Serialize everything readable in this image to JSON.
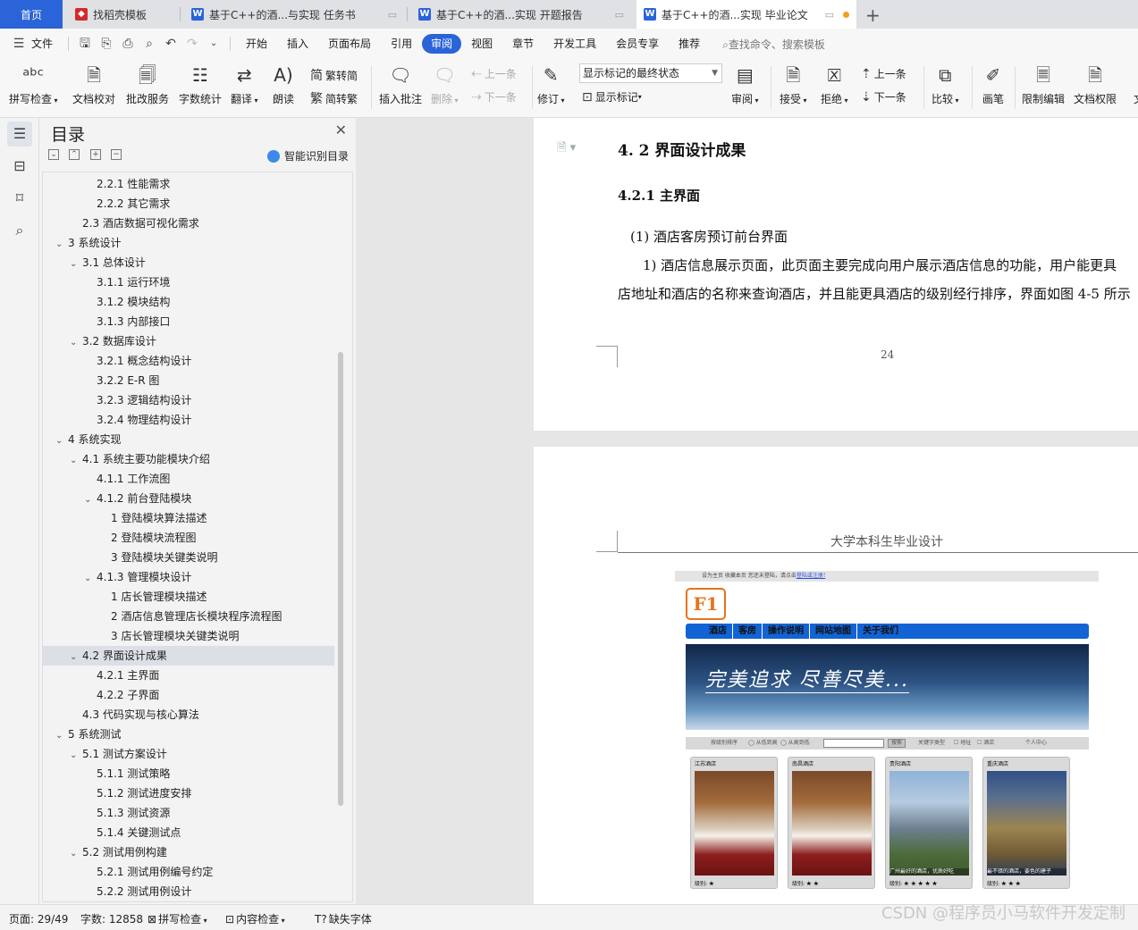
{
  "tabs": [
    {
      "label": "首页"
    },
    {
      "label": "找稻壳模板"
    },
    {
      "label": "基于C++的酒...与实现 任务书"
    },
    {
      "label": "基于C++的酒...实现 开题报告"
    },
    {
      "label": "基于C++的酒...实现 毕业论文"
    }
  ],
  "menu": {
    "file": "文件",
    "items": [
      "开始",
      "插入",
      "页面布局",
      "引用",
      "审阅",
      "视图",
      "章节",
      "开发工具",
      "会员专享",
      "推荐"
    ],
    "active": "审阅",
    "search": "查找命令、搜索模板"
  },
  "ribbon": {
    "spell_check": "拼写检查",
    "doc_proof": "文档校对",
    "batch_service": "批改服务",
    "word_count": "字数统计",
    "translate": "翻译",
    "read_aloud": "朗读",
    "trad_to_simp": "繁转简",
    "simp_to_trad": "简转繁",
    "insert_comment": "插入批注",
    "delete": "删除",
    "prev_comment": "上一条",
    "next_comment": "下一条",
    "track_changes": "修订",
    "markup_state": "显示标记的最终状态",
    "show_markup": "显示标记",
    "review": "审阅",
    "accept": "接受",
    "reject": "拒绝",
    "prev_change": "上一条",
    "next_change": "下一条",
    "compare": "比较",
    "pen": "画笔",
    "restrict_edit": "限制编辑",
    "doc_permission": "文档权限",
    "more": "文"
  },
  "toc": {
    "title": "目录",
    "smart": "智能识别目录",
    "selected": "4.2 界面设计成果",
    "items": [
      {
        "text": "2.2.1 性能需求",
        "level": 3,
        "chev": ""
      },
      {
        "text": "2.2.2 其它需求",
        "level": 3,
        "chev": ""
      },
      {
        "text": "2.3 酒店数据可视化需求",
        "level": 2,
        "chev": ""
      },
      {
        "text": "3 系统设计",
        "level": 1,
        "chev": "v"
      },
      {
        "text": "3.1 总体设计",
        "level": 2,
        "chev": "v"
      },
      {
        "text": "3.1.1 运行环境",
        "level": 3,
        "chev": ""
      },
      {
        "text": "3.1.2 模块结构",
        "level": 3,
        "chev": ""
      },
      {
        "text": "3.1.3 内部接口",
        "level": 3,
        "chev": ""
      },
      {
        "text": "3.2 数据库设计",
        "level": 2,
        "chev": "v"
      },
      {
        "text": "3.2.1 概念结构设计",
        "level": 3,
        "chev": ""
      },
      {
        "text": "3.2.2 E-R 图",
        "level": 3,
        "chev": ""
      },
      {
        "text": "3.2.3 逻辑结构设计",
        "level": 3,
        "chev": ""
      },
      {
        "text": "3.2.4 物理结构设计",
        "level": 3,
        "chev": ""
      },
      {
        "text": "4 系统实现",
        "level": 1,
        "chev": "v"
      },
      {
        "text": "4.1 系统主要功能模块介绍",
        "level": 2,
        "chev": "v"
      },
      {
        "text": "4.1.1 工作流图",
        "level": 3,
        "chev": ""
      },
      {
        "text": "4.1.2 前台登陆模块",
        "level": 3,
        "chev": "v"
      },
      {
        "text": "1 登陆模块算法描述",
        "level": 4,
        "chev": ""
      },
      {
        "text": "2 登陆模块流程图",
        "level": 4,
        "chev": ""
      },
      {
        "text": "3 登陆模块关键类说明",
        "level": 4,
        "chev": ""
      },
      {
        "text": "4.1.3 管理模块设计",
        "level": 3,
        "chev": "v"
      },
      {
        "text": "1 店长管理模块描述",
        "level": 4,
        "chev": ""
      },
      {
        "text": "2 酒店信息管理店长模块程序流程图",
        "level": 4,
        "chev": ""
      },
      {
        "text": "3 店长管理模块关键类说明",
        "level": 4,
        "chev": ""
      },
      {
        "text": "4.2 界面设计成果",
        "level": 2,
        "chev": "v"
      },
      {
        "text": "4.2.1 主界面",
        "level": 3,
        "chev": ""
      },
      {
        "text": "4.2.2 子界面",
        "level": 3,
        "chev": ""
      },
      {
        "text": "4.3 代码实现与核心算法",
        "level": 2,
        "chev": ""
      },
      {
        "text": "5 系统测试",
        "level": 1,
        "chev": "v"
      },
      {
        "text": "5.1 测试方案设计",
        "level": 2,
        "chev": "v"
      },
      {
        "text": "5.1.1 测试策略",
        "level": 3,
        "chev": ""
      },
      {
        "text": "5.1.2 测试进度安排",
        "level": 3,
        "chev": ""
      },
      {
        "text": "5.1.3 测试资源",
        "level": 3,
        "chev": ""
      },
      {
        "text": "5.1.4 关键测试点",
        "level": 3,
        "chev": ""
      },
      {
        "text": "5.2 测试用例构建",
        "level": 2,
        "chev": "v"
      },
      {
        "text": "5.2.1 测试用例编号约定",
        "level": 3,
        "chev": ""
      },
      {
        "text": "5.2.2 测试用例设计",
        "level": 3,
        "chev": ""
      }
    ]
  },
  "document": {
    "heading_42": "4. 2  界面设计成果",
    "heading_421": "4.2.1  主界面",
    "heading_1": "(1)    酒店客房预订前台界面",
    "para_line1": "1) 酒店信息展示页面，此页面主要完成向用户展示酒店信息的功能，用户能更具",
    "para_line2": "店地址和酒店的名称来查询酒店，并且能更具酒店的级别经行排序，界面如图 4-5 所示",
    "page_number": "24",
    "running_header": "大学本科生毕业设计"
  },
  "screenshot": {
    "topbar_text": "设为主页  收藏本页  您还未登陆，请点击",
    "topbar_link": "登陆或注册!",
    "logo": "F1",
    "nav": [
      "酒店",
      "客房",
      "操作说明",
      "网站地图",
      "关于我们"
    ],
    "banner": "完美追求  尽善尽美...",
    "search": {
      "sort_label": "按级别排序",
      "opt_high": "从低到高",
      "opt_low": "从高到低",
      "button": "搜索",
      "type_label": "关键字类型",
      "opt_addr": "地址",
      "opt_hotel": "酒店",
      "user_center": "个人中心"
    },
    "hotels": [
      {
        "name": "江苏酒店",
        "rating": "级别:  ★",
        "caption": ""
      },
      {
        "name": "南昌酒店",
        "rating": "级别:  ★ ★",
        "caption": ""
      },
      {
        "name": "贵阳酒店",
        "rating": "级别:  ★ ★ ★ ★ ★",
        "caption": "广州最好的酒店，优质好吃"
      },
      {
        "name": "重庆酒店",
        "rating": "级别:  ★ ★ ★",
        "caption": "最不错的酒店，要色的建子"
      }
    ]
  },
  "status": {
    "page": "页面: 29/49",
    "words": "字数: 12858",
    "spell": "拼写检查",
    "content_check": "内容检查",
    "missing_font": "缺失字体"
  },
  "watermark": "CSDN @程序员小马软件开发定制"
}
